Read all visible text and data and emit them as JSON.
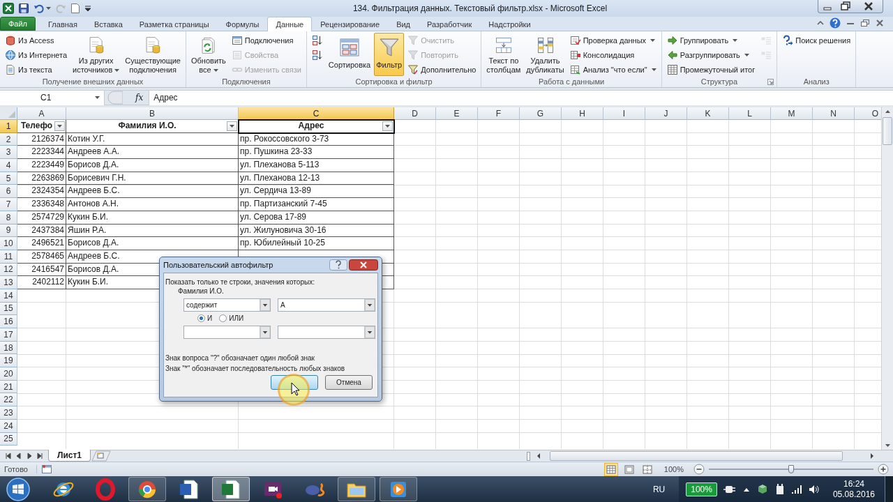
{
  "window": {
    "title": "134. Фильтрация данных. Текстовый фильтр.xlsx  -  Microsoft Excel"
  },
  "tabs": [
    {
      "label": "Файл",
      "kind": "file",
      "selected": false
    },
    {
      "label": "Главная",
      "kind": "tab",
      "selected": false
    },
    {
      "label": "Вставка",
      "kind": "tab",
      "selected": false
    },
    {
      "label": "Разметка страницы",
      "kind": "tab",
      "selected": false
    },
    {
      "label": "Формулы",
      "kind": "tab",
      "selected": false
    },
    {
      "label": "Данные",
      "kind": "tab",
      "selected": true
    },
    {
      "label": "Рецензирование",
      "kind": "tab",
      "selected": false
    },
    {
      "label": "Вид",
      "kind": "tab",
      "selected": false
    },
    {
      "label": "Разработчик",
      "kind": "tab",
      "selected": false
    },
    {
      "label": "Надстройки",
      "kind": "tab",
      "selected": false
    }
  ],
  "ribbon": {
    "groups": [
      {
        "label": "Получение внешних данных",
        "sections": [
          {
            "kind": "stack",
            "items": [
              {
                "label": "Из Access",
                "disabled": false
              },
              {
                "label": "Из Интернета",
                "disabled": false
              },
              {
                "label": "Из текста",
                "disabled": false
              }
            ]
          },
          {
            "kind": "large",
            "items": [
              {
                "label": "Из других\nисточников",
                "dropdown": true,
                "disabled": false
              },
              {
                "label": "Существующие\nподключения",
                "disabled": false
              }
            ]
          }
        ]
      },
      {
        "label": "Подключения",
        "sections": [
          {
            "kind": "large",
            "items": [
              {
                "label": "Обновить\nвсе",
                "dropdown": true,
                "disabled": false
              }
            ]
          },
          {
            "kind": "stack",
            "items": [
              {
                "label": "Подключения",
                "disabled": false
              },
              {
                "label": "Свойства",
                "disabled": true
              },
              {
                "label": "Изменить связи",
                "disabled": true
              }
            ]
          }
        ]
      },
      {
        "label": "Сортировка и фильтр",
        "sections": [
          {
            "kind": "stack",
            "items": [
              {
                "disabled": false
              },
              {
                "disabled": false
              }
            ]
          },
          {
            "kind": "large",
            "items": [
              {
                "label": "Сортировка",
                "disabled": false
              },
              {
                "label": "Фильтр",
                "disabled": false,
                "selected": true
              }
            ]
          },
          {
            "kind": "stack",
            "items": [
              {
                "label": "Очистить",
                "disabled": true
              },
              {
                "label": "Повторить",
                "disabled": true
              },
              {
                "label": "Дополнительно",
                "disabled": false
              }
            ]
          }
        ]
      },
      {
        "label": "Работа с данными",
        "sections": [
          {
            "kind": "large",
            "items": [
              {
                "label": "Текст по\nстолбцам",
                "disabled": false
              },
              {
                "label": "Удалить\nдубликаты",
                "disabled": false
              }
            ]
          },
          {
            "kind": "stack",
            "items": [
              {
                "label": "Проверка данных",
                "dropdown": true,
                "disabled": false
              },
              {
                "label": "Консолидация",
                "disabled": false
              },
              {
                "label": "Анализ \"что если\"",
                "dropdown": true,
                "disabled": false
              }
            ]
          }
        ]
      },
      {
        "label": "Структура",
        "launcher": true,
        "sections": [
          {
            "kind": "stack",
            "items": [
              {
                "label": "Группировать",
                "dropdown": true,
                "disabled": false
              },
              {
                "label": "Разгруппировать",
                "dropdown": true,
                "disabled": false
              },
              {
                "label": "Промежуточный итог",
                "disabled": false
              }
            ]
          },
          {
            "kind": "stack",
            "items": [
              {
                "disabled": true
              },
              {
                "disabled": true
              }
            ]
          }
        ]
      },
      {
        "label": "Анализ",
        "sections": [
          {
            "kind": "stack",
            "items": [
              {
                "label": "Поиск решения",
                "disabled": false
              }
            ]
          }
        ]
      }
    ]
  },
  "formula_bar": {
    "name_box": "C1",
    "function_button": "fx",
    "value": "Адрес"
  },
  "sheet": {
    "columns": [
      {
        "label": "A",
        "selected": false
      },
      {
        "label": "B",
        "selected": false
      },
      {
        "label": "C",
        "selected": true
      },
      {
        "label": "D",
        "selected": false
      },
      {
        "label": "E",
        "selected": false
      },
      {
        "label": "F",
        "selected": false
      },
      {
        "label": "G",
        "selected": false
      },
      {
        "label": "H",
        "selected": false
      },
      {
        "label": "I",
        "selected": false
      },
      {
        "label": "J",
        "selected": false
      },
      {
        "label": "K",
        "selected": false
      },
      {
        "label": "L",
        "selected": false
      },
      {
        "label": "M",
        "selected": false
      },
      {
        "label": "N",
        "selected": false
      },
      {
        "label": "O",
        "selected": false
      }
    ],
    "rows": [
      {
        "number": "1",
        "kind": "header",
        "selected": true,
        "cells": [
          {
            "text": "Телефо",
            "filter": true,
            "selected": false
          },
          {
            "text": "Фамилия И.О.",
            "filter": true,
            "selected": false
          },
          {
            "text": "Адрес",
            "filter": true,
            "selected": true
          }
        ]
      },
      {
        "number": "2",
        "kind": "data",
        "selected": false,
        "cells": [
          {
            "text": "2126374",
            "selected": false
          },
          {
            "text": "Котин У.Г.",
            "selected": false
          },
          {
            "text": "пр. Рокоссовского 3-73",
            "selected": false
          }
        ]
      },
      {
        "number": "3",
        "kind": "data",
        "selected": false,
        "cells": [
          {
            "text": "2223344",
            "selected": false
          },
          {
            "text": "Андреев А.А.",
            "selected": false
          },
          {
            "text": "пр. Пушкина 23-33",
            "selected": false
          }
        ]
      },
      {
        "number": "4",
        "kind": "data",
        "selected": false,
        "cells": [
          {
            "text": "2223449",
            "selected": false
          },
          {
            "text": "Борисов Д.А.",
            "selected": false
          },
          {
            "text": "ул. Плеханова 5-113",
            "selected": false
          }
        ]
      },
      {
        "number": "5",
        "kind": "data",
        "selected": false,
        "cells": [
          {
            "text": "2263869",
            "selected": false
          },
          {
            "text": "Борисевич Г.Н.",
            "selected": false
          },
          {
            "text": "ул. Плеханова 12-13",
            "selected": false
          }
        ]
      },
      {
        "number": "6",
        "kind": "data",
        "selected": false,
        "cells": [
          {
            "text": "2324354",
            "selected": false
          },
          {
            "text": "Андреев Б.С.",
            "selected": false
          },
          {
            "text": "ул. Сердича 13-89",
            "selected": false
          }
        ]
      },
      {
        "number": "7",
        "kind": "data",
        "selected": false,
        "cells": [
          {
            "text": "2336348",
            "selected": false
          },
          {
            "text": "Антонов А.Н.",
            "selected": false
          },
          {
            "text": "пр. Партизанский 7-45",
            "selected": false
          }
        ]
      },
      {
        "number": "8",
        "kind": "data",
        "selected": false,
        "cells": [
          {
            "text": "2574729",
            "selected": false
          },
          {
            "text": "Кукин Б.И.",
            "selected": false
          },
          {
            "text": "ул. Серова 17-89",
            "selected": false
          }
        ]
      },
      {
        "number": "9",
        "kind": "data",
        "selected": false,
        "cells": [
          {
            "text": "2437384",
            "selected": false
          },
          {
            "text": "Яшин Р.А.",
            "selected": false
          },
          {
            "text": "ул. Жилуновича 30-16",
            "selected": false
          }
        ]
      },
      {
        "number": "10",
        "kind": "data",
        "selected": false,
        "cells": [
          {
            "text": "2496521",
            "selected": false
          },
          {
            "text": "Борисов Д.А.",
            "selected": false
          },
          {
            "text": "пр. Юбилейный 10-25",
            "selected": false
          }
        ]
      },
      {
        "number": "11",
        "kind": "data",
        "selected": false,
        "cells": [
          {
            "text": "2578465",
            "selected": false
          },
          {
            "text": "Андреев Б.С.",
            "selected": false
          },
          {
            "selected": false
          }
        ]
      },
      {
        "number": "12",
        "kind": "data",
        "selected": false,
        "cells": [
          {
            "text": "2416547",
            "selected": false
          },
          {
            "text": "Борисов Д.А.",
            "selected": false
          },
          {
            "selected": false
          }
        ]
      },
      {
        "number": "13",
        "kind": "data",
        "selected": false,
        "cells": [
          {
            "text": "2402112",
            "selected": false
          },
          {
            "text": "Кукин Б.И.",
            "selected": false
          },
          {
            "selected": false
          }
        ]
      },
      {
        "number": "14",
        "kind": "empty",
        "selected": false
      },
      {
        "number": "15",
        "kind": "empty",
        "selected": false
      },
      {
        "number": "16",
        "kind": "empty",
        "selected": false
      },
      {
        "number": "17",
        "kind": "empty",
        "selected": false
      },
      {
        "number": "18",
        "kind": "empty",
        "selected": false
      },
      {
        "number": "19",
        "kind": "empty",
        "selected": false
      },
      {
        "number": "20",
        "kind": "empty",
        "selected": false
      },
      {
        "number": "21",
        "kind": "empty",
        "selected": false
      },
      {
        "number": "22",
        "kind": "empty",
        "selected": false
      },
      {
        "number": "23",
        "kind": "empty",
        "selected": false
      },
      {
        "number": "24",
        "kind": "empty",
        "selected": false
      },
      {
        "number": "25",
        "kind": "empty",
        "selected": false
      }
    ]
  },
  "sheet_tabs": [
    {
      "label": "Лист1",
      "selected": true
    }
  ],
  "dialog": {
    "title": "Пользовательский автофильтр",
    "prompt": "Показать только те строки, значения которых:",
    "field": "Фамилия И.О.",
    "conditions": [
      {
        "operator": "содержит",
        "value": "А"
      }
    ],
    "joins": [
      {
        "label": "И",
        "selected": true
      },
      {
        "label": "ИЛИ",
        "selected": false
      }
    ],
    "hints": [
      "Знак вопроса \"?\" обозначает один любой знак",
      "Знак \"*\" обозначает последовательность любых знаков"
    ],
    "buttons": [
      {
        "kind": "ok"
      },
      {
        "kind": "cancel",
        "label": "Отмена"
      }
    ]
  },
  "status_bar": {
    "text": "Готово",
    "views": [
      {
        "selected": true
      },
      {
        "selected": false
      },
      {
        "selected": false
      }
    ],
    "zoom": "100%",
    "zoom_slider": {
      "level": 0.5
    }
  },
  "taskbar": {
    "apps": [
      {
        "selected": false,
        "running": false
      },
      {
        "selected": false,
        "running": false
      },
      {
        "selected": false,
        "running": true
      },
      {
        "selected": false,
        "running": false
      },
      {
        "selected": true,
        "running": true
      },
      {
        "selected": false,
        "running": false
      },
      {
        "selected": false,
        "running": false
      },
      {
        "selected": false,
        "running": true
      },
      {
        "selected": false,
        "running": true
      }
    ],
    "tray": {
      "language": "RU",
      "battery": "100%",
      "time": "16:24",
      "date": "05.08.2016"
    }
  }
}
